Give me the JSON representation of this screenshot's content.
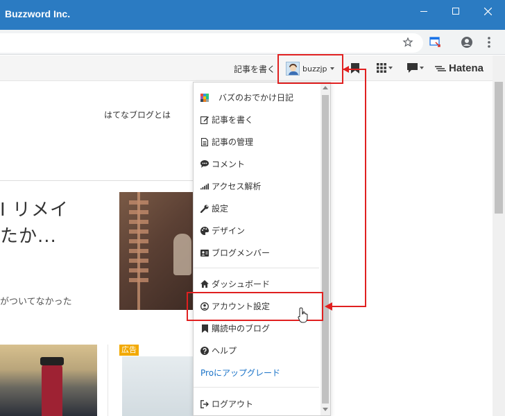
{
  "window": {
    "title": "Buzzword Inc.",
    "controls": [
      "minimize-icon",
      "maximize-icon",
      "close-icon"
    ]
  },
  "browser_toolbar": {
    "icons": [
      "star-icon",
      "extension-icon",
      "account-icon",
      "more-vert-icon"
    ]
  },
  "hatena_header": {
    "write_label": "記事を書く",
    "username": "buzzjp",
    "icons": [
      "bookmark-icon",
      "apps-grid-icon",
      "comment-icon"
    ],
    "logo": "Hatena"
  },
  "page": {
    "about_link": "はてなブログとは",
    "headline_line1": "I リメイ",
    "headline_line2": "たか...",
    "excerpt": "がついてなかった",
    "ad_badge": "広告"
  },
  "dropdown": {
    "blog_name": "バズのおでかけ日記",
    "items": [
      {
        "label": "記事を書く",
        "icon": "edit-icon"
      },
      {
        "label": "記事の管理",
        "icon": "document-icon"
      },
      {
        "label": "コメント",
        "icon": "comment-icon"
      },
      {
        "label": "アクセス解析",
        "icon": "signal-bars-icon"
      },
      {
        "label": "設定",
        "icon": "wrench-icon"
      },
      {
        "label": "デザイン",
        "icon": "palette-icon"
      },
      {
        "label": "ブログメンバー",
        "icon": "member-card-icon"
      }
    ],
    "account_items": [
      {
        "label": "ダッシュボード",
        "icon": "home-icon"
      },
      {
        "label": "アカウント設定",
        "icon": "user-circle-icon"
      },
      {
        "label": "購読中のブログ",
        "icon": "bookmark-icon"
      },
      {
        "label": "ヘルプ",
        "icon": "question-icon"
      }
    ],
    "upgrade_label": "Proにアップグレード",
    "logout_label": "ログアウト"
  },
  "colors": {
    "titlebar": "#2b7bc2",
    "annotation": "#e02020",
    "link": "#1a73c8",
    "ad": "#f2a900"
  }
}
